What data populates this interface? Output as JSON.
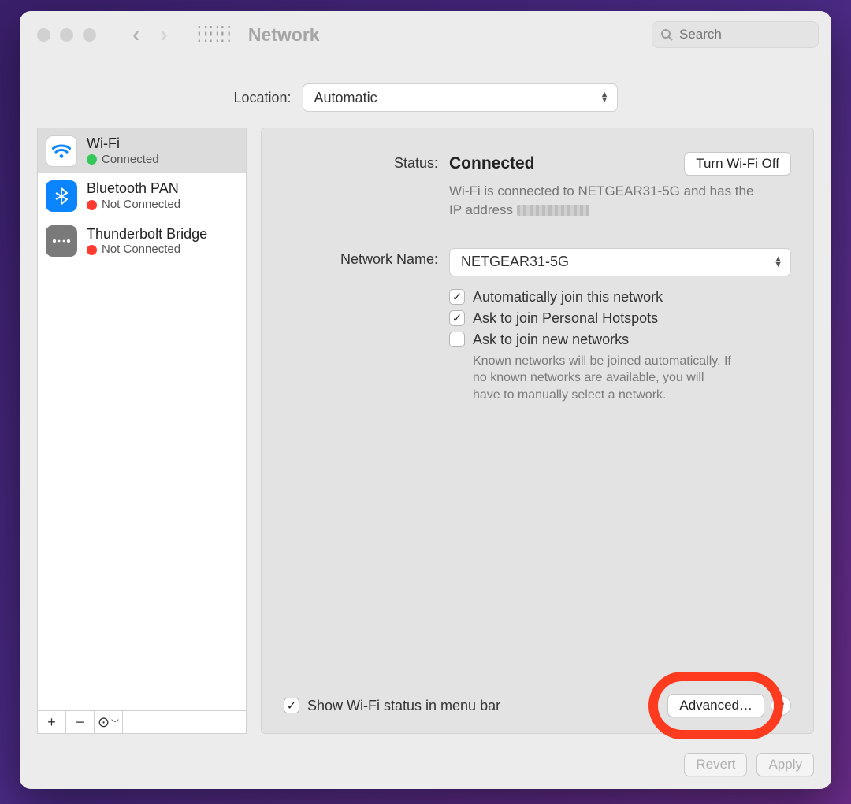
{
  "window": {
    "title": "Network",
    "search_placeholder": "Search"
  },
  "location": {
    "label": "Location:",
    "value": "Automatic"
  },
  "sidebar": {
    "items": [
      {
        "name": "Wi-Fi",
        "status": "Connected",
        "status_color": "green",
        "icon": "wifi",
        "selected": true
      },
      {
        "name": "Bluetooth PAN",
        "status": "Not Connected",
        "status_color": "red",
        "icon": "bt",
        "selected": false
      },
      {
        "name": "Thunderbolt Bridge",
        "status": "Not Connected",
        "status_color": "red",
        "icon": "tb",
        "selected": false
      }
    ],
    "tools": {
      "add": "+",
      "remove": "−",
      "more": "⊙"
    }
  },
  "detail": {
    "status_label": "Status:",
    "status_value": "Connected",
    "wifi_toggle": "Turn Wi-Fi Off",
    "substatus_prefix": "Wi-Fi is connected to NETGEAR31-5G and has the IP address ",
    "network_name_label": "Network Name:",
    "network_name_value": "NETGEAR31-5G",
    "checks": [
      {
        "label": "Automatically join this network",
        "checked": true
      },
      {
        "label": "Ask to join Personal Hotspots",
        "checked": true
      },
      {
        "label": "Ask to join new networks",
        "checked": false
      }
    ],
    "help_text": "Known networks will be joined automatically. If no known networks are available, you will have to manually select a network.",
    "show_status_label": "Show Wi-Fi status in menu bar",
    "show_status_checked": true,
    "advanced_button": "Advanced…",
    "help_button": "?"
  },
  "footer": {
    "revert": "Revert",
    "apply": "Apply"
  }
}
